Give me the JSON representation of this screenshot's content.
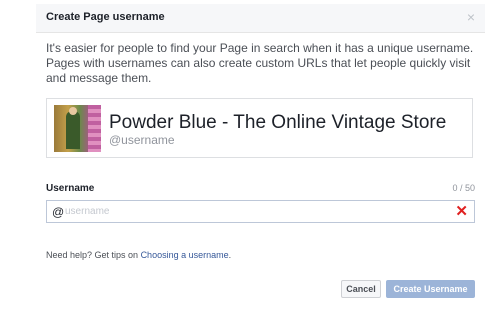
{
  "dialog": {
    "title": "Create Page username",
    "close_glyph": "×",
    "intro_text": "It's easier for people to find your Page in search when it has a unique username. Pages with usernames can also create custom URLs that let people quickly visit and message them."
  },
  "preview": {
    "page_name": "Powder Blue - The Online Vintage Store",
    "username_placeholder": "@username"
  },
  "field": {
    "label": "Username",
    "char_count": "0 / 50",
    "prefix": "@",
    "value": "",
    "placeholder": "username",
    "clear_glyph": "✕"
  },
  "help": {
    "prefix": "Need help? Get tips on ",
    "link_text": "Choosing a username",
    "suffix": "."
  },
  "buttons": {
    "cancel": "Cancel",
    "create": "Create Username"
  },
  "colors": {
    "link": "#365899",
    "clear_icon": "#e02020",
    "create_button_disabled": "#9cb4d8"
  }
}
